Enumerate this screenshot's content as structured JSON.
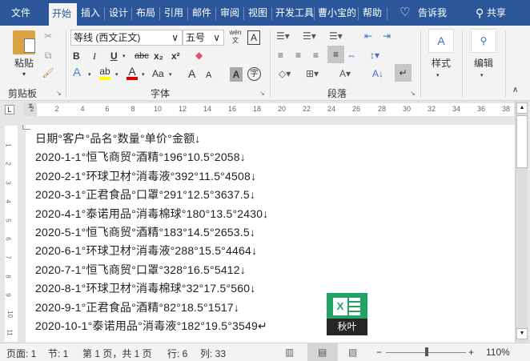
{
  "tabs": [
    "文件",
    "开始",
    "插入",
    "设计",
    "布局",
    "引用",
    "邮件",
    "审阅",
    "视图",
    "开发工具",
    "曹小宝的",
    "帮助"
  ],
  "tell_me": "告诉我",
  "share": "共享",
  "ribbon": {
    "clipboard": {
      "label": "剪贴板",
      "paste": "粘贴"
    },
    "font": {
      "label": "字体",
      "font_name": "等线 (西文正文)",
      "font_size": "五号",
      "bold": "B",
      "italic": "I",
      "underline": "U",
      "strike": "abc",
      "sub": "x₂",
      "sup": "x²",
      "grow": "A",
      "case": "Aa",
      "phonetic": "wén",
      "char_border": "A",
      "shade": "A",
      "enclose": "字"
    },
    "paragraph": {
      "label": "段落"
    },
    "styles": {
      "label": "样式"
    },
    "editing": {
      "label": "编辑"
    }
  },
  "ruler": {
    "h_ticks": [
      "2",
      "2",
      "4",
      "6",
      "8",
      "10",
      "12",
      "14",
      "16",
      "18",
      "20",
      "22",
      "24",
      "26",
      "28",
      "30",
      "32",
      "34",
      "36",
      "38"
    ],
    "v_ticks": [
      "1",
      "2",
      "3",
      "4",
      "5",
      "6",
      "7",
      "8",
      "9",
      "10",
      "11"
    ]
  },
  "document": {
    "lines": [
      "日期°客户°品名°数量°单价°金额↓",
      "2020-1-1°恒飞商贸°酒精°196°10.5°2058↓",
      "2020-2-1°环球卫材°消毒液°392°11.5°4508↓",
      "2020-3-1°正君食品°口罩°291°12.5°3637.5↓",
      "2020-4-1°泰诺用品°消毒棉球°180°13.5°2430↓",
      "2020-5-1°恒飞商贸°酒精°183°14.5°2653.5↓",
      "2020-6-1°环球卫材°消毒液°288°15.5°4464↓",
      "2020-7-1°恒飞商贸°口罩°328°16.5°5412↓",
      "2020-8-1°环球卫材°消毒棉球°32°17.5°560↓",
      "2020-9-1°正君食品°酒精°82°18.5°1517↓",
      "2020-10-1°泰诺用品°消毒液°182°19.5°3549↵"
    ]
  },
  "watermark": {
    "text": "秋叶",
    "letter": "X"
  },
  "status": {
    "page": "页面: 1",
    "section": "节: 1",
    "pages": "第 1 页，共 1 页",
    "row": "行: 6",
    "col": "列: 33",
    "zoom": "110%",
    "minus": "−",
    "plus": "+",
    "zoom_level": 110
  },
  "colors": {
    "accent": "#2b579a",
    "highlight": "#ffff00",
    "font_color": "#e00000"
  }
}
